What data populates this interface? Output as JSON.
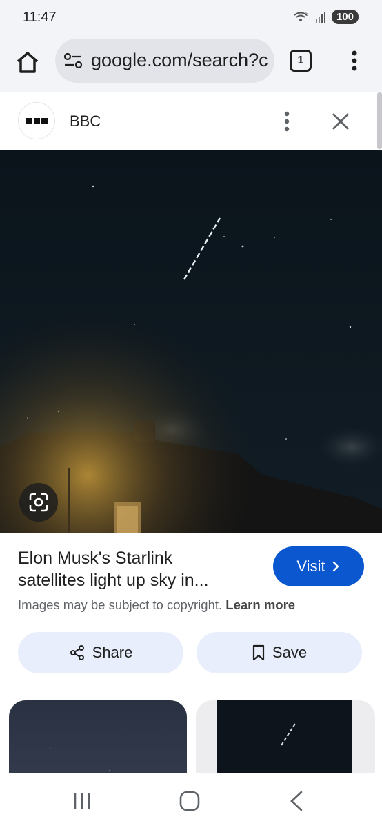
{
  "status_bar": {
    "time": "11:47",
    "battery": "100",
    "icons": [
      "wifi-5g-icon",
      "signal-icon",
      "battery-icon"
    ]
  },
  "browser": {
    "url": "google.com/search?c",
    "tab_count": "1",
    "icons": [
      "home-icon",
      "tune-icon",
      "more-vert-icon"
    ]
  },
  "panel": {
    "source_name": "BBC"
  },
  "result": {
    "title_line1": "Elon Musk's Starlink",
    "title_line2": "satellites light up sky in...",
    "visit_label": "Visit",
    "copyright_text": "Images may be subject to copyright.",
    "learn_more": "Learn more",
    "share_label": "Share",
    "save_label": "Save"
  },
  "colors": {
    "accent": "#0b57d0",
    "chip_bg": "#e8eefb",
    "bar_bg": "#f3f4f8"
  }
}
